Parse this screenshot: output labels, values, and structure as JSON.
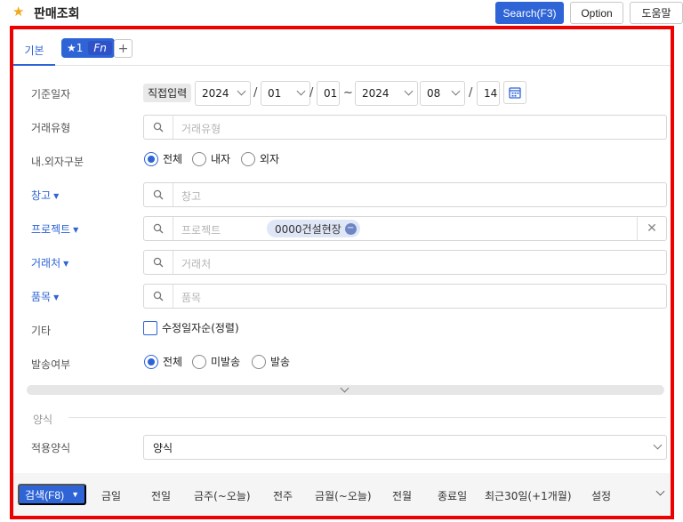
{
  "header": {
    "title": "판매조회",
    "search_button": "Search(F3)",
    "option_button": "Option",
    "help_button": "도움말"
  },
  "tabs": {
    "basic": "기본",
    "favorite": "★1",
    "fn": "Fn",
    "add": "+"
  },
  "form": {
    "base_date": {
      "label": "기준일자",
      "mode": "직접입력",
      "from_year": "2024",
      "from_month": "01",
      "from_day": "01",
      "range_sep": "~",
      "to_year": "2024",
      "to_month": "08",
      "to_day": "14",
      "date_sep": "/"
    },
    "trade_type": {
      "label": "거래유형",
      "placeholder": "거래유형"
    },
    "inout_type": {
      "label": "내.외자구분",
      "options": [
        "전체",
        "내자",
        "외자"
      ],
      "selected": "전체"
    },
    "warehouse": {
      "label": "창고",
      "placeholder": "창고"
    },
    "project": {
      "label": "프로젝트",
      "placeholder": "프로젝트",
      "chip": "0000건설현장"
    },
    "customer": {
      "label": "거래처",
      "placeholder": "거래처"
    },
    "item": {
      "label": "품목",
      "placeholder": "품목"
    },
    "etc": {
      "label": "기타",
      "checkbox": "수정일자순(정렬)"
    },
    "send_status": {
      "label": "발송여부",
      "options": [
        "전체",
        "미발송",
        "발송"
      ],
      "selected": "전체"
    }
  },
  "format_section": {
    "title": "양식",
    "label": "적용양식",
    "value": "양식"
  },
  "bottom_bar": {
    "search": "검색(F8)",
    "quick": [
      "금일",
      "전일",
      "금주(~오늘)",
      "전주",
      "금월(~오늘)",
      "전월",
      "종료일",
      "최근30일(+1개월)",
      "설정"
    ]
  },
  "colors": {
    "primary": "#2e64d6",
    "highlight_border": "#ee0000",
    "star": "#f0a81c"
  }
}
